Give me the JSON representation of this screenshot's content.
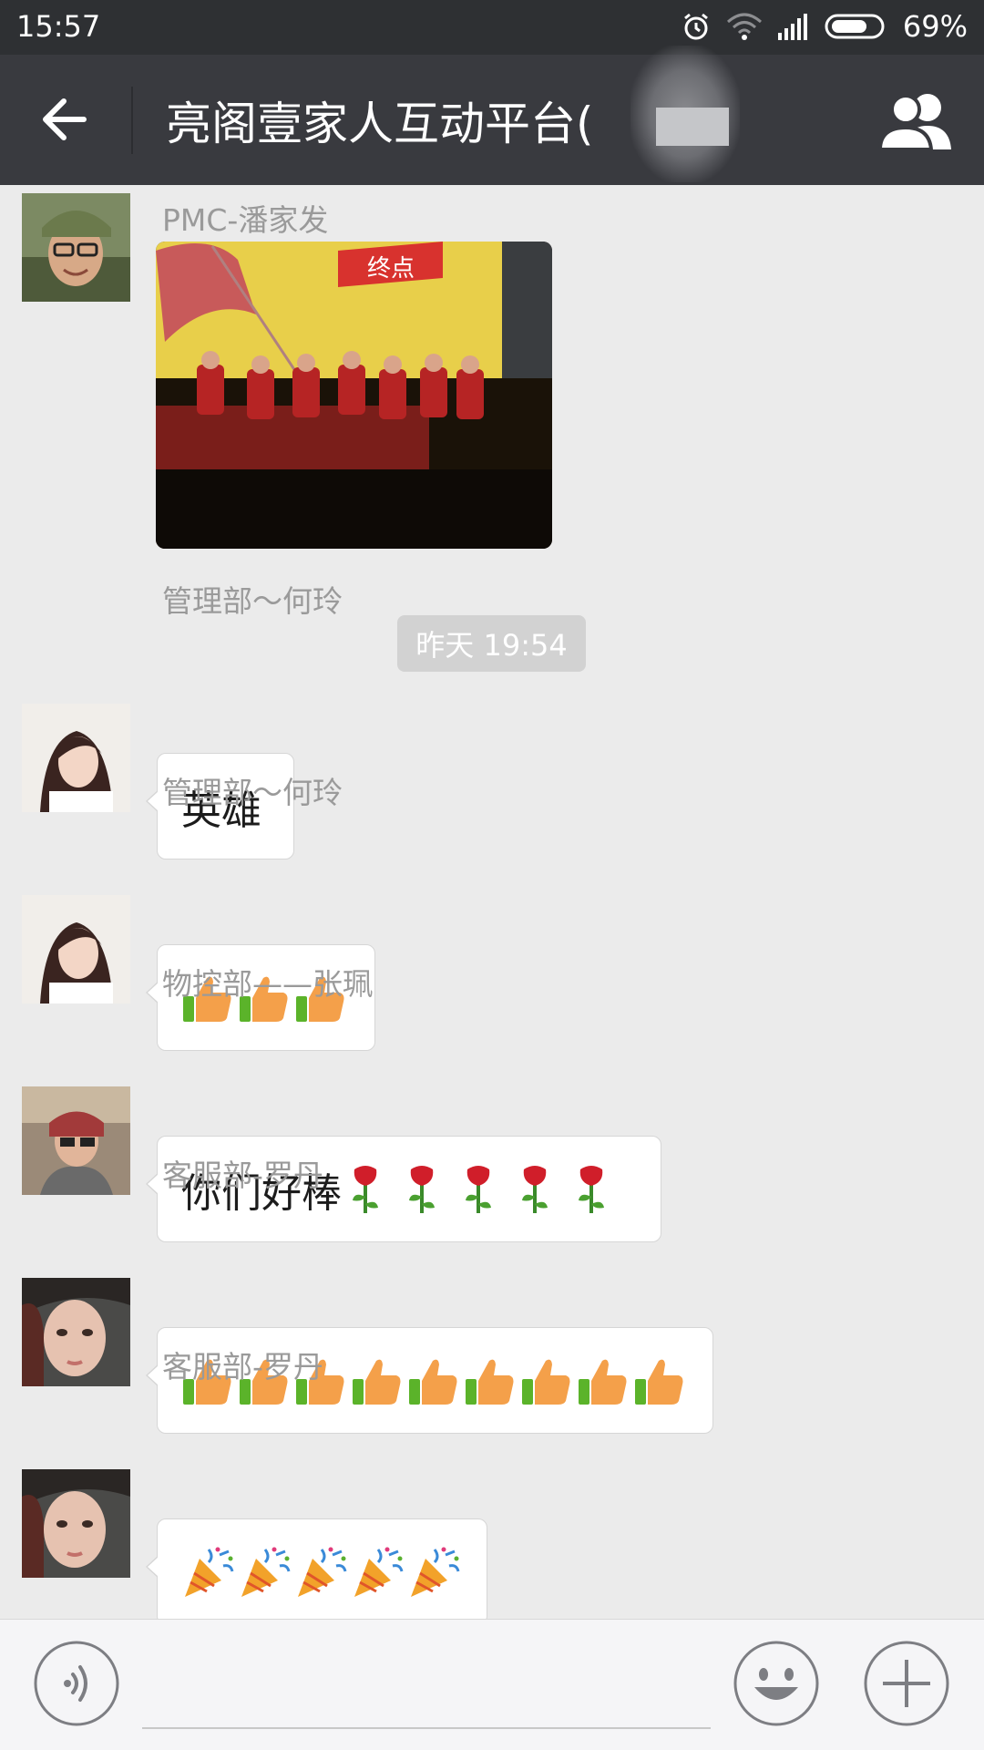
{
  "status_bar": {
    "time": "15:57",
    "battery_percent": "69%",
    "icons": [
      "alarm-icon",
      "wifi-icon",
      "signal-icon",
      "battery-icon"
    ]
  },
  "header": {
    "title": "亮阁壹家人互动平台(",
    "back_icon": "back-arrow-icon",
    "group_icon": "group-members-icon"
  },
  "messages": [
    {
      "sender": "PMC-潘家发",
      "type": "image",
      "image_text": "终点"
    },
    {
      "type": "timestamp",
      "text": "昨天 19:54"
    },
    {
      "sender": "管理部～何玲",
      "type": "text",
      "text": "英雄"
    },
    {
      "sender": "管理部～何玲",
      "type": "emoji",
      "emoji": "thumbs-up-icon",
      "count": 3
    },
    {
      "sender": "物控部——张珮",
      "type": "text",
      "text": "你们好棒",
      "trailing_emoji": "rose-icon",
      "trailing_count": 5
    },
    {
      "sender": "客服部-罗丹",
      "type": "emoji",
      "emoji": "thumbs-up-icon",
      "count": 9
    },
    {
      "sender": "客服部-罗丹",
      "type": "emoji",
      "emoji": "party-popper-icon",
      "count": 5
    }
  ],
  "input_bar": {
    "voice_icon": "voice-input-icon",
    "emoji_icon": "emoji-icon",
    "plus_icon": "plus-icon",
    "input_value": ""
  },
  "colors": {
    "status_bar": "#2e3033",
    "title_bar": "#393a3f",
    "chat_bg": "#ebebeb",
    "bubble": "#ffffff",
    "sender_text": "#9a9a9a"
  }
}
